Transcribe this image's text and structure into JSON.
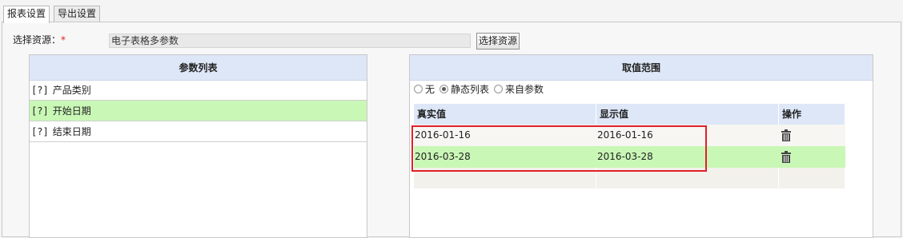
{
  "tabs": [
    {
      "label": "报表设置",
      "active": true
    },
    {
      "label": "导出设置",
      "active": false
    }
  ],
  "resource": {
    "label": "选择资源：",
    "required_mark": "*",
    "value": "电子表格多参数",
    "button_label": "选择资源"
  },
  "param_list": {
    "title": "参数列表",
    "icon": "[?]",
    "items": [
      {
        "label": "产品类别",
        "selected": false
      },
      {
        "label": "开始日期",
        "selected": true
      },
      {
        "label": "结束日期",
        "selected": false
      }
    ]
  },
  "value_range": {
    "title": "取值范围",
    "options": [
      {
        "label": "无",
        "checked": false
      },
      {
        "label": "静态列表",
        "checked": true
      },
      {
        "label": "来自参数",
        "checked": false
      }
    ],
    "columns": [
      "真实值",
      "显示值",
      "操作"
    ],
    "rows": [
      {
        "real": "2016-01-16",
        "display": "2016-01-16"
      },
      {
        "real": "2016-03-28",
        "display": "2016-03-28"
      }
    ]
  },
  "colors": {
    "header_bg": "#dde7f7",
    "selected_row": "#c9f7b6",
    "highlight_border": "#e0202a",
    "required": "#e02020"
  }
}
